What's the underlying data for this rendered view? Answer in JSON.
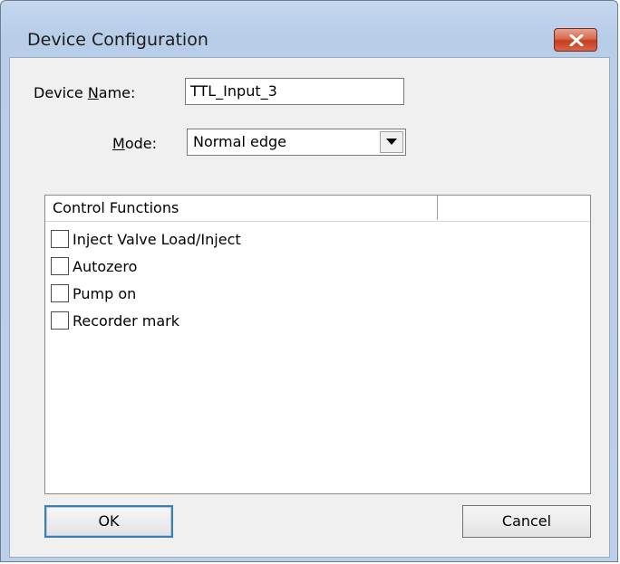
{
  "window": {
    "title": "Device Configuration",
    "close_icon": "close-icon"
  },
  "form": {
    "device_name_label_pre": "Device ",
    "device_name_label_accel": "N",
    "device_name_label_post": "ame:",
    "device_name_value": "TTL_Input_3",
    "mode_label_accel": "M",
    "mode_label_post": "ode:",
    "mode_value": "Normal edge"
  },
  "list": {
    "columns": [
      "Control Functions",
      ""
    ],
    "items": [
      {
        "label": "Inject Valve Load/Inject",
        "checked": false
      },
      {
        "label": "Autozero",
        "checked": false
      },
      {
        "label": "Pump on",
        "checked": false
      },
      {
        "label": "Recorder mark",
        "checked": false
      }
    ]
  },
  "buttons": {
    "ok": "OK",
    "cancel": "Cancel"
  }
}
